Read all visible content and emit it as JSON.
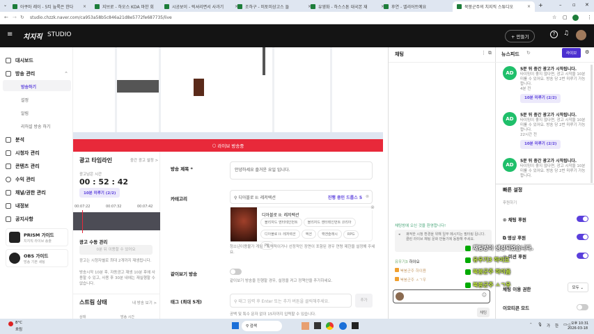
{
  "browser": {
    "tabs": [
      "아쿠마 레이 - 5티 늪룩은 한다",
      "지브로 - 하오스 KDA 마한 회",
      "시공보이 - 럭셔리면서 사과기",
      "조하구 - 미토미상고스 들",
      "유영화 - 하스스톤 대국본 재",
      "후연 - 엘리어트예요",
      "북붕군주의 치지직 스튜디오"
    ],
    "url": "studio.chzzk.naver.com/ca953a58b5c846a21d8e5772fe687735/live"
  },
  "header": {
    "logo": "치지직",
    "studio": "STUDIO",
    "create": "+ 만들기"
  },
  "sidebar": {
    "items": [
      "대시보드",
      "방송 관리",
      "분석",
      "시청자 관리",
      "콘텐츠 관리",
      "수익 관리",
      "채널/권한 관리",
      "내정보",
      "공지사항"
    ],
    "subs": [
      "방송하기",
      "설정",
      "알림",
      "리허설 방송 하기"
    ],
    "guides": [
      {
        "title": "PRISM 가이드",
        "sub": "치지직 라이브 송출"
      },
      {
        "title": "OBS 가이드",
        "sub": "방송 기본 세팅"
      }
    ]
  },
  "live_banner": "라이브 방송중",
  "ad": {
    "title": "광고 타임라인",
    "setting": "중간 광고 설정 >",
    "remain_label": "광고남은 시간",
    "remain": "00 : 52 : 42",
    "postpone": "10분 미루기 (2/2)",
    "ticks": [
      "00:07:22",
      "00:07:32",
      "00:07:42"
    ],
    "manual": "광고 수동 관리",
    "manual_btn": "0분 뒤 이용할 수 있어요",
    "notes": [
      "광고는 시청자별로 최대 2개까지 재생됩니다.",
      "방송시작 10분 후, 자동광고 재생 10분 후에 사용할 수 있고, 사용 후 30분 내에는 재실행할 수 없습니다."
    ],
    "stream_title": "스트림 상태",
    "my_stream": "내 방송 보기 >",
    "col1": "상태",
    "col2": "방송 시간"
  },
  "form": {
    "title_label": "방송 제목 *",
    "title_value": "안녕하세요 즐거운 요일 입니다.",
    "cat_label": "카테고리",
    "cat_value": "디아블로 II: 레저렉션",
    "cat_drops": "진행 중인 드롭스 5",
    "game": "디아블로 II: 레저렉션",
    "chips": [
      "블리자드 엔터테인먼트",
      "블리자드 엔터테인먼트 코리아",
      "디아블로 II: 레저렉션",
      "액션",
      "핵앤슬래시",
      "RPG",
      "PC"
    ],
    "cat_note": "청소년이용불가 게임 : 폭력적이거나 선정적인 장면이 포함된 경우 연령 제한을 설정해 주세요.",
    "watch_label": "같이보기 방송",
    "watch_note": "같이보기 방송을 진행할 경우, 설정을 켜고 정책안을 추가하세요.",
    "tag_label": "태그 (최대 5개)",
    "tag_placeholder": "태그 입력 후 Enter 또는 추가 버튼을 클릭해주세요.",
    "tag_add": "추가",
    "tag_note": "공백 및 특수 문자 없이 15자까지 입력할 수 있습니다."
  },
  "chat": {
    "title": "채팅",
    "welcome": "채팅방에 오신 것을 환영합니다!",
    "notice": "쾌적한 시청 환경을 위해 일부 메시지는 필터링 됩니다. 클린 라이브 채팅 문화 만들기에 동참해 주세요.",
    "messages": [
      {
        "user": "유우기3",
        "text": "하이요"
      },
      {
        "user": "북붕군주",
        "text": "하이욤"
      },
      {
        "user": "북붕군주",
        "text": "ㅅㄱ우"
      }
    ],
    "send": "채팅",
    "overlay": [
      "채팅방이 생성되었습니다.",
      "유우기3 하이요",
      "북붕군주 하이욤",
      "북붕군주 ㅅㄱ우"
    ]
  },
  "feed": {
    "title": "뉴스피드",
    "live": "라이브",
    "items": [
      {
        "title": "5분 뒤 중간 광고가 시작됩니다.",
        "body": "타이밍이 좋지 않다면, 광고 시작을 10분 미룰 수 있어요. 방송 당 2번 미루기 가능합니다.",
        "time": "4분 전",
        "btn": "10분 미루기 (2/2)"
      },
      {
        "title": "5분 뒤 중간 광고가 시작됩니다.",
        "body": "타이밍이 좋지 않다면, 광고 시작을 10분 미룰 수 있어요. 방송 당 2번 미루기 가능합니다.",
        "time": "22시간 전",
        "btn": "10분 미루기 (2/2)"
      },
      {
        "title": "5분 뒤 중간 광고가 시작됩니다.",
        "body": "타이밍이 좋지 않다면, 광고 시작을 10분 미룰 수 있어요. 방송 당 2번 미루기 가능합니다."
      }
    ]
  },
  "quick": {
    "title": "빠른 설정",
    "section": "후원하기",
    "rows": [
      "채팅 후원",
      "영상 후원",
      "미션 후원"
    ],
    "chat_perm": "채팅 이용 권한",
    "perm_value": "모두",
    "emoji": "이모티콘 모드"
  },
  "taskbar": {
    "weather": "8°C",
    "weather2": "흐림",
    "search": "검색",
    "time": "오후 10:31",
    "date": "2026-03-18",
    "ime1": "가",
    "ime2": "한"
  }
}
